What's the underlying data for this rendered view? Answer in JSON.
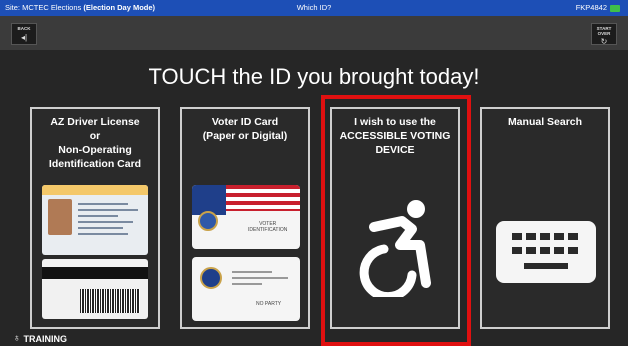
{
  "topbar": {
    "site_prefix": "Site: MCTEC Elections",
    "site_mode": "(Election Day Mode)",
    "center": "Which ID?",
    "right_code": "FKP4842"
  },
  "toolbar": {
    "back_label": "BACK",
    "start_over_label": "START OVER"
  },
  "prompt": "TOUCH the ID you brought today!",
  "options": [
    {
      "line1": "AZ Driver License",
      "line2": "or",
      "line3": "Non-Operating",
      "line4": "Identification Card"
    },
    {
      "line1": "Voter ID Card",
      "line2": "(Paper or Digital)"
    },
    {
      "line1": "I wish to use the",
      "line2": "ACCESSIBLE VOTING",
      "line3": "DEVICE"
    },
    {
      "line1": "Manual Search"
    }
  ],
  "card_text": {
    "voter_id_a": "VOTER",
    "voter_id_b": "IDENTIFICATION",
    "voter_id_party": "NO PARTY"
  },
  "footer": {
    "mode": "TRAINING"
  },
  "colors": {
    "topbar": "#1d4fb6",
    "highlight": "#e01010",
    "background": "#262626"
  },
  "icons": [
    "back-icon",
    "refresh-icon",
    "battery-icon",
    "accessible-icon",
    "keyboard-icon",
    "lightbulb-icon"
  ]
}
